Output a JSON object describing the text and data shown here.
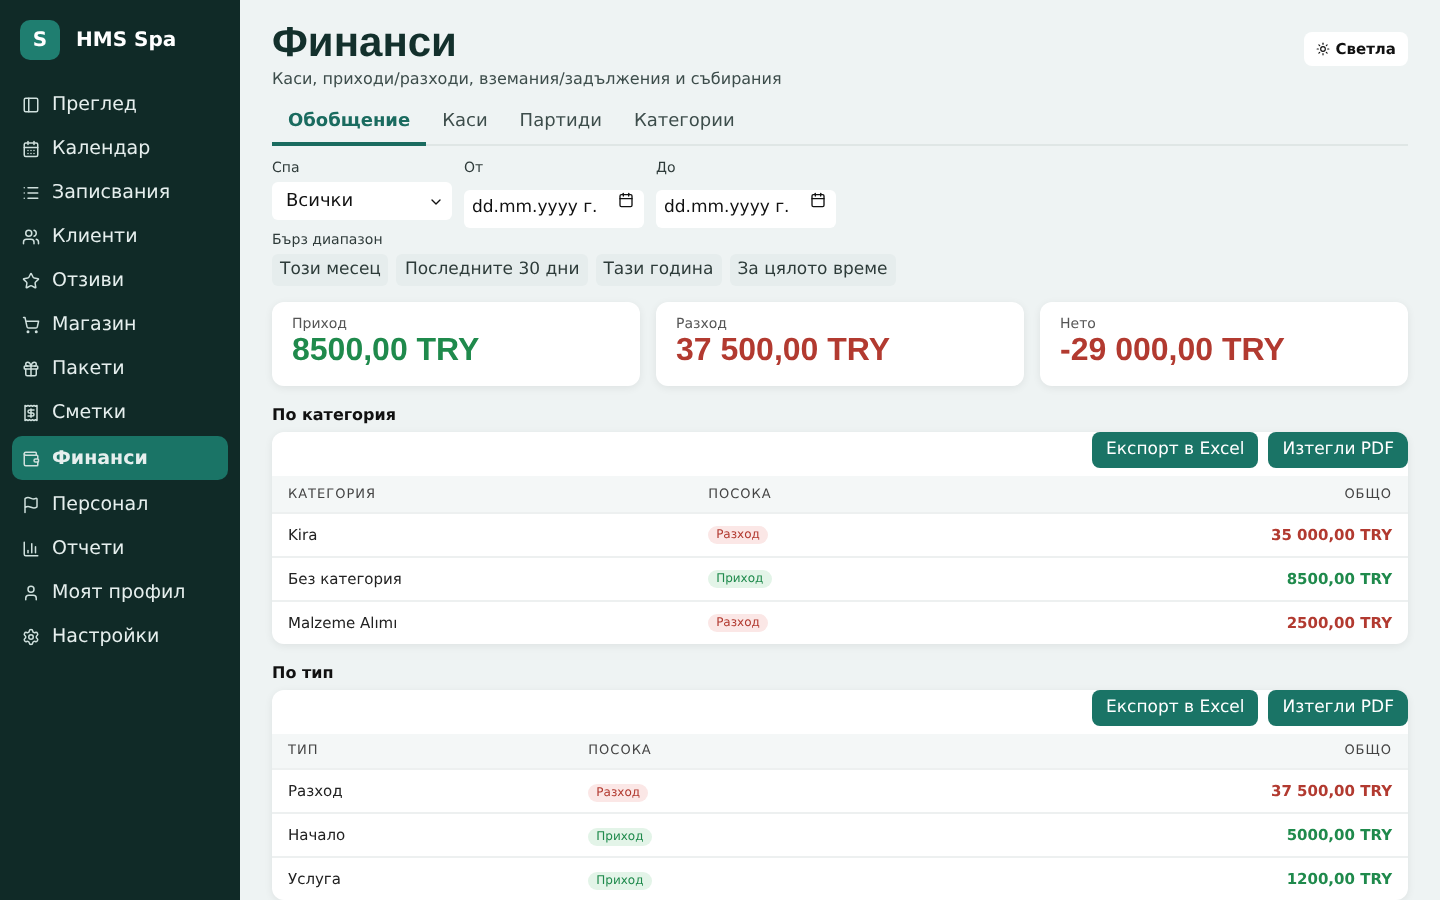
{
  "brand": {
    "initial": "S",
    "name": "HMS Spa"
  },
  "sidebar": {
    "items": [
      {
        "label": "Преглед",
        "selected": false
      },
      {
        "label": "Календар",
        "selected": false
      },
      {
        "label": "Записвания",
        "selected": false
      },
      {
        "label": "Клиенти",
        "selected": false
      },
      {
        "label": "Отзиви",
        "selected": false
      },
      {
        "label": "Магазин",
        "selected": false
      },
      {
        "label": "Пакети",
        "selected": false
      },
      {
        "label": "Сметки",
        "selected": false
      },
      {
        "label": "Финанси",
        "selected": true
      },
      {
        "label": "Персонал",
        "selected": false
      },
      {
        "label": "Отчети",
        "selected": false
      },
      {
        "label": "Моят профил",
        "selected": false
      },
      {
        "label": "Настройки",
        "selected": false
      }
    ]
  },
  "header": {
    "title": "Финанси",
    "subtitle": "Каси, приходи/разходи, вземания/задължения и събирания",
    "theme_button": "Светла"
  },
  "tabs": [
    {
      "label": "Обобщение",
      "selected": true
    },
    {
      "label": "Каси",
      "selected": false
    },
    {
      "label": "Партиди",
      "selected": false
    },
    {
      "label": "Категории",
      "selected": false
    }
  ],
  "filters": {
    "spa": {
      "label": "Спа",
      "value": "Всички"
    },
    "from": {
      "label": "От",
      "placeholder": "dd.mm.yyyy г."
    },
    "to": {
      "label": "До",
      "placeholder": "dd.mm.yyyy г."
    }
  },
  "quick_range": {
    "label": "Бърз диапазон",
    "options": [
      "Този месец",
      "Последните 30 дни",
      "Тази година",
      "За цялото време"
    ]
  },
  "summary": [
    {
      "label": "Приход",
      "value": "8500,00 TRY",
      "kind": "income"
    },
    {
      "label": "Разход",
      "value": "37 500,00 TRY",
      "kind": "expense"
    },
    {
      "label": "Нето",
      "value": "-29 000,00 TRY",
      "kind": "expense"
    }
  ],
  "sections": [
    {
      "title": "По категория",
      "buttons": [
        "Експорт в Excel",
        "Изтегли PDF"
      ],
      "columns": [
        "КАТЕГОРИЯ",
        "ПОСОКА",
        "ОБЩО"
      ],
      "rows": [
        {
          "name": "Kira",
          "direction": "Разход",
          "kind": "expense",
          "total": "35 000,00 TRY"
        },
        {
          "name": "Без категория",
          "direction": "Приход",
          "kind": "income",
          "total": "8500,00 TRY"
        },
        {
          "name": "Malzeme Alımı",
          "direction": "Разход",
          "kind": "expense",
          "total": "2500,00 TRY"
        }
      ]
    },
    {
      "title": "По тип",
      "buttons": [
        "Експорт в Excel",
        "Изтегли PDF"
      ],
      "columns": [
        "ТИП",
        "ПОСОКА",
        "ОБЩО"
      ],
      "rows": [
        {
          "name": "Разход",
          "direction": "Разход",
          "kind": "expense",
          "total": "37 500,00 TRY"
        },
        {
          "name": "Начало",
          "direction": "Приход",
          "kind": "income",
          "total": "5000,00 TRY"
        },
        {
          "name": "Услуга",
          "direction": "Приход",
          "kind": "income",
          "total": "1200,00 TRY"
        }
      ]
    }
  ]
}
